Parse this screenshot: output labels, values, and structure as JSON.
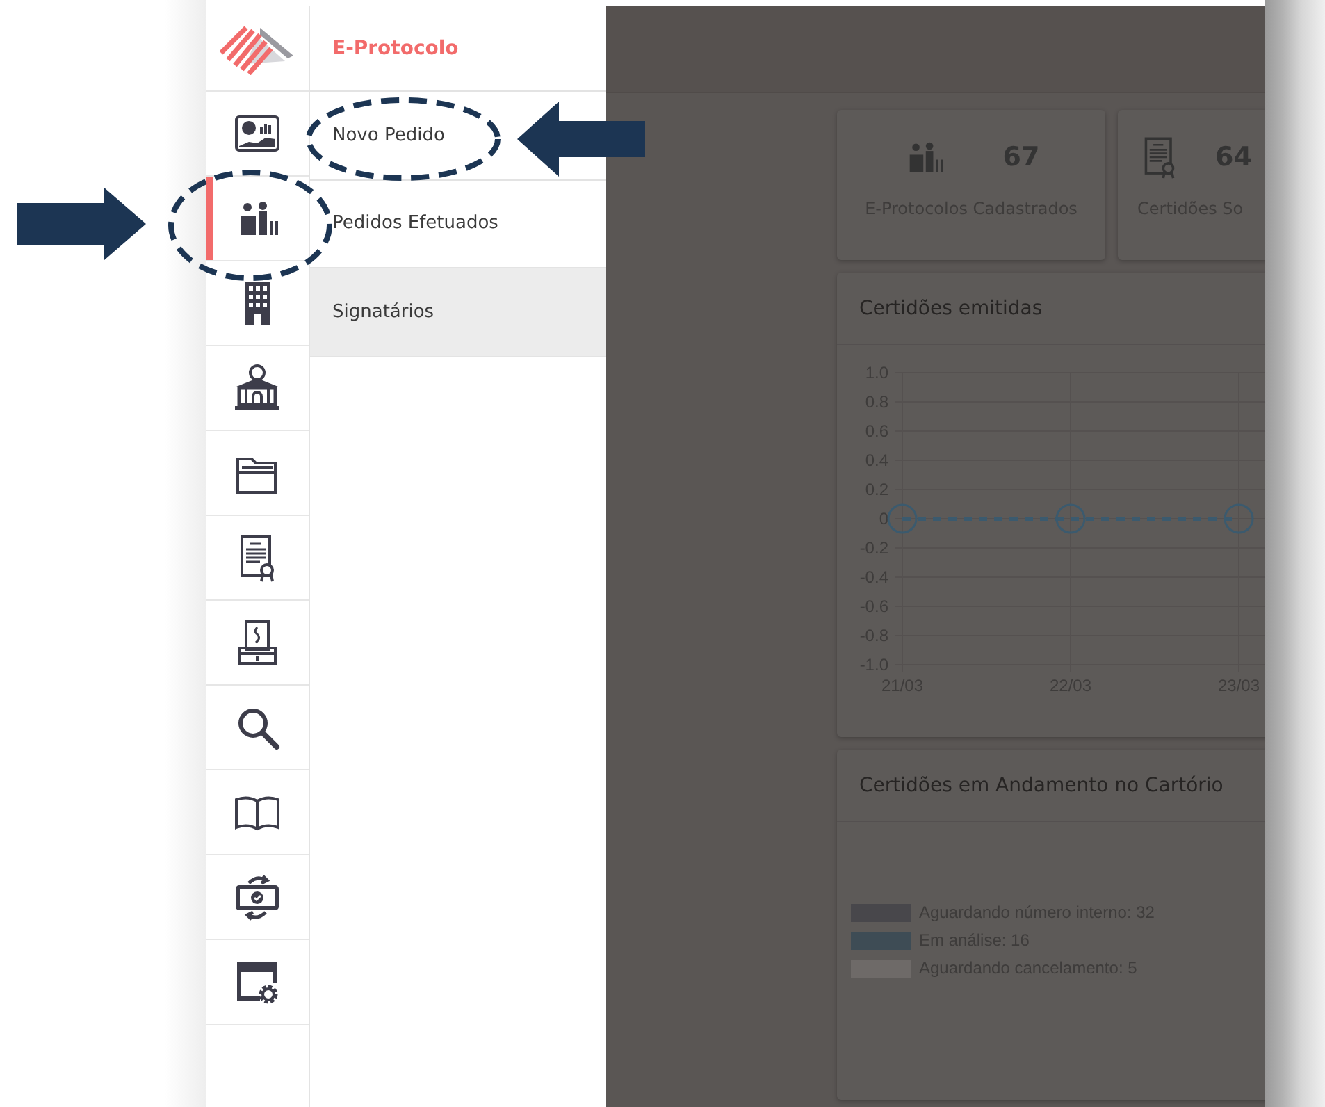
{
  "rail": {
    "items": [
      {
        "selected": false
      },
      {
        "selected": true
      },
      {
        "selected": false
      },
      {
        "selected": false
      },
      {
        "selected": false
      },
      {
        "selected": false
      },
      {
        "selected": false
      },
      {
        "selected": false
      },
      {
        "selected": false
      },
      {
        "selected": false
      },
      {
        "selected": false
      }
    ]
  },
  "submenu": {
    "title": "E-Protocolo",
    "items": [
      {
        "label": "Novo Pedido",
        "selected": false
      },
      {
        "label": "Pedidos Efetuados",
        "selected": false
      },
      {
        "label": "Signatários",
        "selected": true
      }
    ]
  },
  "stats": [
    {
      "value": "67",
      "label": "E-Protocolos Cadastrados"
    },
    {
      "value": "64",
      "label": "Certidões So"
    }
  ],
  "chart_card": {
    "title": "Certidões emitidas",
    "chart_data": {
      "type": "line",
      "categories": [
        "21/03",
        "22/03",
        "23/03"
      ],
      "grid": true,
      "series": [
        {
          "color": "#3b5a6e",
          "values": [
            0,
            0,
            0
          ],
          "line_style": "dashed",
          "marker": "circle"
        }
      ],
      "ylim": [
        -1,
        1
      ],
      "yticks": [
        {
          "value": 1,
          "label": "1.0"
        },
        0.8,
        0.6,
        0.4,
        0.2,
        0,
        -0.2,
        -0.4,
        -0.6,
        -0.8,
        {
          "value": -1,
          "label": "-1.0"
        }
      ]
    }
  },
  "legend_card": {
    "title": "Certidões em Andamento no Cartório",
    "items": [
      {
        "label": "Aguardando número interno: 32",
        "color": "#48474b"
      },
      {
        "label": "Em análise: 16",
        "color": "#3e4c55"
      },
      {
        "label": "Aguardando cancelamento: 5",
        "color": "#6e6a68"
      }
    ]
  }
}
